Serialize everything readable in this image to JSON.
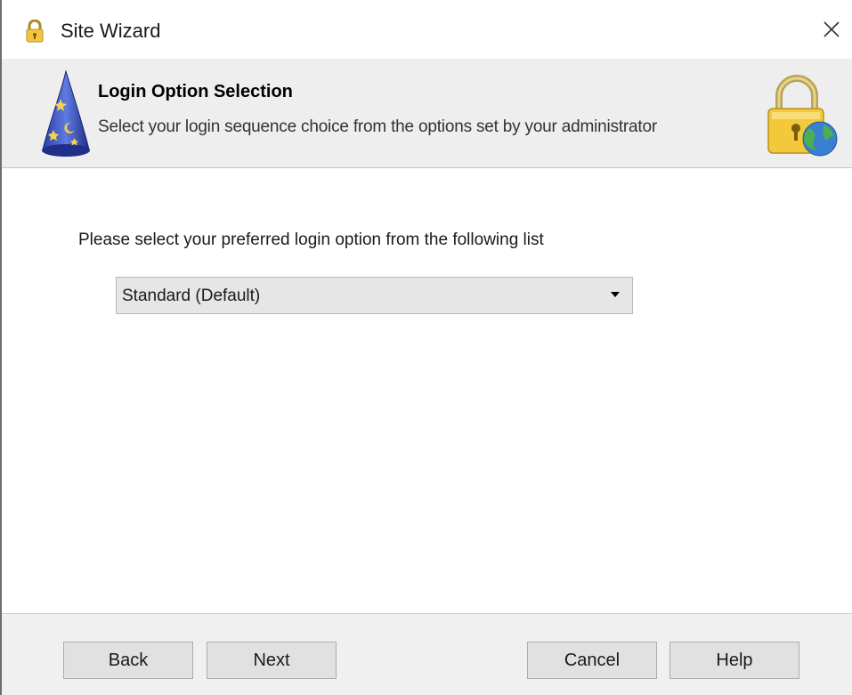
{
  "window": {
    "title": "Site Wizard",
    "icons": [
      "padlock-icon",
      "close-icon"
    ]
  },
  "header": {
    "title": "Login Option Selection",
    "subtitle": "Select your login sequence choice from the options set by your administrator",
    "icons": [
      "wizard-hat-icon",
      "padlock-globe-icon"
    ]
  },
  "main": {
    "prompt": "Please select your preferred  login option from the following list",
    "login_option": {
      "selected": "Standard  (Default)"
    }
  },
  "footer": {
    "back_label": "Back",
    "next_label": "Next",
    "cancel_label": "Cancel",
    "help_label": "Help"
  },
  "colors": {
    "header_bg": "#eeeeee",
    "footer_bg": "#f0f0f0",
    "button_bg": "#e1e1e1",
    "dropdown_bg": "#e6e6e6"
  }
}
